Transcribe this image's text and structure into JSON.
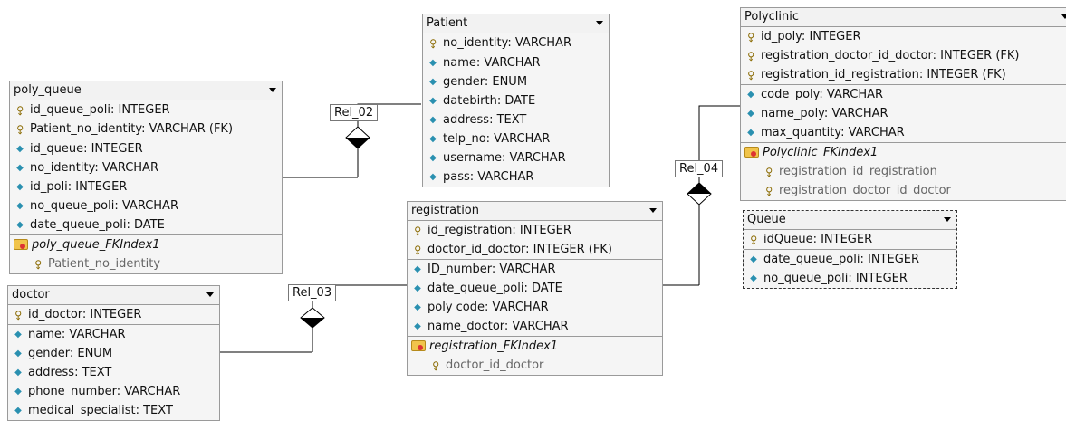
{
  "tables": {
    "patient": {
      "title": "Patient",
      "rows": [
        {
          "icon": "key-icon",
          "text": "no_identity: VARCHAR"
        },
        {
          "icon": "attribute-icon",
          "text": "name: VARCHAR"
        },
        {
          "icon": "attribute-icon",
          "text": "gender: ENUM"
        },
        {
          "icon": "attribute-icon",
          "text": "datebirth: DATE"
        },
        {
          "icon": "attribute-icon",
          "text": "address: TEXT"
        },
        {
          "icon": "attribute-icon",
          "text": "telp_no: VARCHAR"
        },
        {
          "icon": "attribute-icon",
          "text": "username: VARCHAR"
        },
        {
          "icon": "attribute-icon",
          "text": "pass: VARCHAR"
        }
      ]
    },
    "polyclinic": {
      "title": "Polyclinic",
      "rows": [
        {
          "icon": "key-icon",
          "text": "id_poly: INTEGER"
        },
        {
          "icon": "key-icon",
          "text": "registration_doctor_id_doctor: INTEGER (FK)"
        },
        {
          "icon": "key-icon",
          "text": "registration_id_registration: INTEGER (FK)"
        },
        {
          "icon": "attribute-icon",
          "text": "code_poly: VARCHAR"
        },
        {
          "icon": "attribute-icon",
          "text": "name_poly: VARCHAR"
        },
        {
          "icon": "attribute-icon",
          "text": "max_quantity: VARCHAR"
        },
        {
          "icon": "index-folder-icon",
          "text": "Polyclinic_FKIndex1"
        },
        {
          "icon": "key-icon",
          "text": "registration_id_registration",
          "sub": true
        },
        {
          "icon": "key-icon",
          "text": "registration_doctor_id_doctor",
          "sub": true
        }
      ]
    },
    "poly_queue": {
      "title": "poly_queue",
      "rows": [
        {
          "icon": "key-icon",
          "text": "id_queue_poli: INTEGER"
        },
        {
          "icon": "key-icon",
          "text": "Patient_no_identity: VARCHAR (FK)"
        },
        {
          "icon": "attribute-icon",
          "text": "id_queue: INTEGER"
        },
        {
          "icon": "attribute-icon",
          "text": "no_identity: VARCHAR"
        },
        {
          "icon": "attribute-icon",
          "text": "id_poli: INTEGER"
        },
        {
          "icon": "attribute-icon",
          "text": "no_queue_poli: VARCHAR"
        },
        {
          "icon": "attribute-icon",
          "text": "date_queue_poli: DATE"
        },
        {
          "icon": "index-folder-icon",
          "text": "poly_queue_FKIndex1"
        },
        {
          "icon": "key-icon",
          "text": "Patient_no_identity",
          "sub": true
        }
      ]
    },
    "registration": {
      "title": "registration",
      "rows": [
        {
          "icon": "key-icon",
          "text": "id_registration: INTEGER"
        },
        {
          "icon": "key-icon",
          "text": "doctor_id_doctor: INTEGER (FK)"
        },
        {
          "icon": "attribute-icon",
          "text": "ID_number: VARCHAR"
        },
        {
          "icon": "attribute-icon",
          "text": "date_queue_poli: DATE"
        },
        {
          "icon": "attribute-icon",
          "text": "poly code: VARCHAR"
        },
        {
          "icon": "attribute-icon",
          "text": "name_doctor: VARCHAR"
        },
        {
          "icon": "index-folder-icon",
          "text": "registration_FKIndex1"
        },
        {
          "icon": "key-icon",
          "text": "doctor_id_doctor",
          "sub": true
        }
      ]
    },
    "queue": {
      "title": "Queue",
      "rows": [
        {
          "icon": "key-icon",
          "text": "idQueue: INTEGER"
        },
        {
          "icon": "attribute-icon",
          "text": "date_queue_poli: INTEGER"
        },
        {
          "icon": "attribute-icon",
          "text": "no_queue_poli: INTEGER"
        }
      ]
    },
    "doctor": {
      "title": "doctor",
      "rows": [
        {
          "icon": "key-icon",
          "text": "id_doctor: INTEGER"
        },
        {
          "icon": "attribute-icon",
          "text": "name: VARCHAR"
        },
        {
          "icon": "attribute-icon",
          "text": "gender: ENUM"
        },
        {
          "icon": "attribute-icon",
          "text": "address: TEXT"
        },
        {
          "icon": "attribute-icon",
          "text": "phone_number: VARCHAR"
        },
        {
          "icon": "attribute-icon",
          "text": "medical_specialist: TEXT"
        }
      ]
    }
  },
  "relations": {
    "rel_02": "Rel_02",
    "rel_03": "Rel_03",
    "rel_04": "Rel_04"
  }
}
